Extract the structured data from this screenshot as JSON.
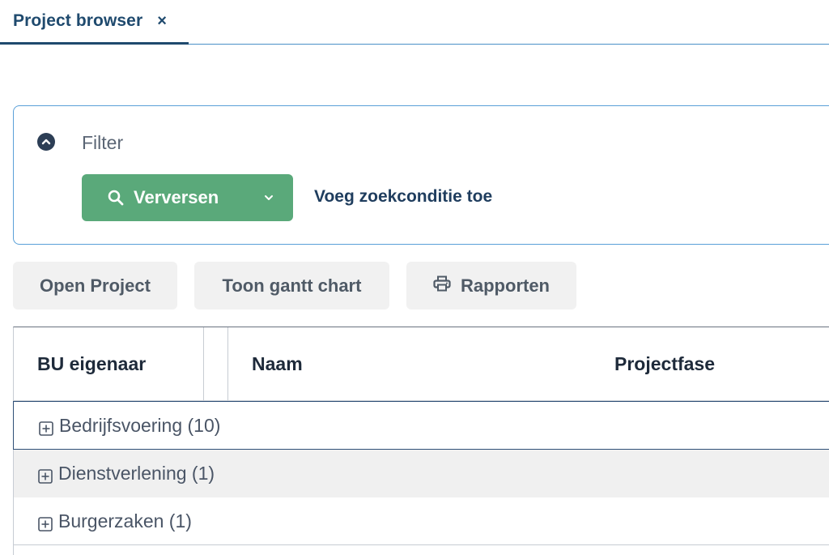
{
  "tabs": [
    {
      "label": "Project browser",
      "close": "×"
    }
  ],
  "filter": {
    "title": "Filter",
    "refresh_label": "Verversen",
    "add_condition_label": "Voeg zoekconditie toe"
  },
  "actions": {
    "open_project": "Open Project",
    "gantt": "Toon gantt chart",
    "reports": "Rapporten"
  },
  "grid": {
    "columns": [
      "BU eigenaar",
      "Naam",
      "Projectfase"
    ],
    "groups": [
      {
        "label": "Bedrijfsvoering (10)"
      },
      {
        "label": "Dienstverlening (1)"
      },
      {
        "label": "Burgerzaken (1)"
      }
    ]
  },
  "colors": {
    "accent": "#1f4a6e",
    "primary_button": "#5aa97a",
    "panel_border": "#5aa0d8"
  },
  "icons": [
    "close-icon",
    "chevron-up-icon",
    "search-icon",
    "chevron-down-icon",
    "printer-icon",
    "expand-plus-icon"
  ]
}
